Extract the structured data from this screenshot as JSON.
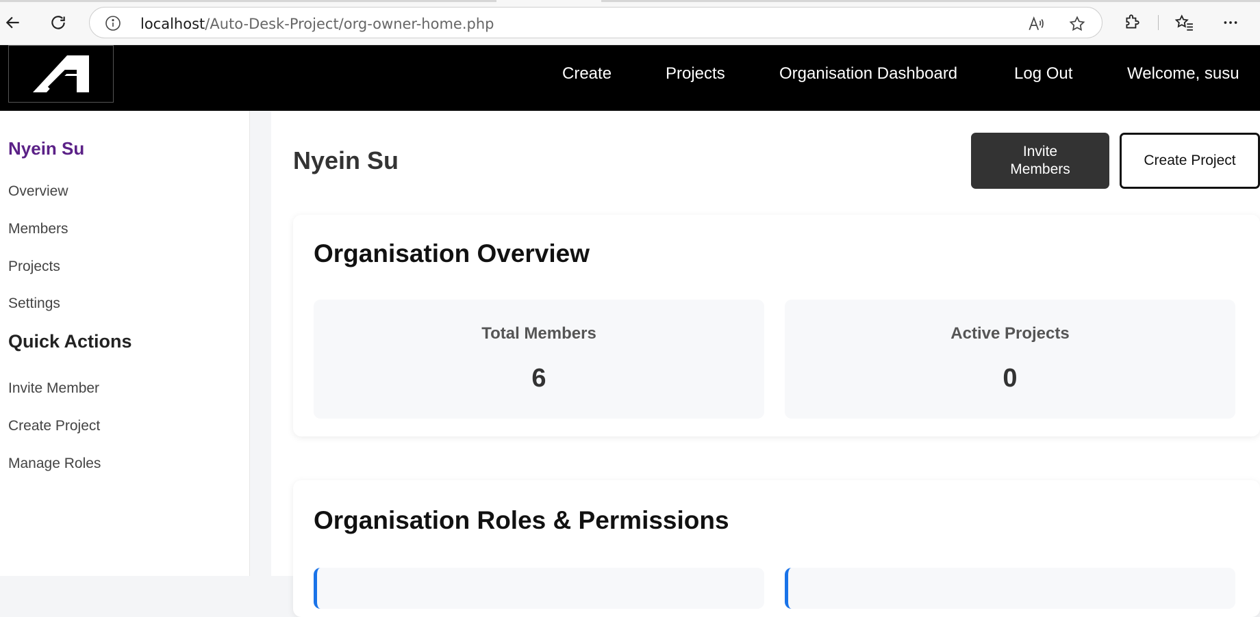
{
  "browser": {
    "url_host": "localhost",
    "url_path": "/Auto-Desk-Project/org-owner-home.php"
  },
  "navbar": {
    "links": [
      "Create",
      "Projects",
      "Organisation Dashboard",
      "Log Out"
    ],
    "welcome": "Welcome, susu"
  },
  "sidebar": {
    "org_name": "Nyein Su",
    "items": [
      "Overview",
      "Members",
      "Projects",
      "Settings"
    ],
    "quick_actions_heading": "Quick Actions",
    "quick_actions": [
      "Invite Member",
      "Create Project",
      "Manage Roles"
    ]
  },
  "main": {
    "title": "Nyein Su",
    "invite_button": "Invite Members",
    "create_button": "Create Project",
    "overview": {
      "heading": "Organisation Overview",
      "stats": [
        {
          "label": "Total Members",
          "value": "6"
        },
        {
          "label": "Active Projects",
          "value": "0"
        }
      ]
    },
    "roles": {
      "heading": "Organisation Roles & Permissions"
    }
  },
  "colors": {
    "org_name": "#5b2187",
    "navbar_bg": "#000000",
    "role_accent": "#1a73e8"
  }
}
